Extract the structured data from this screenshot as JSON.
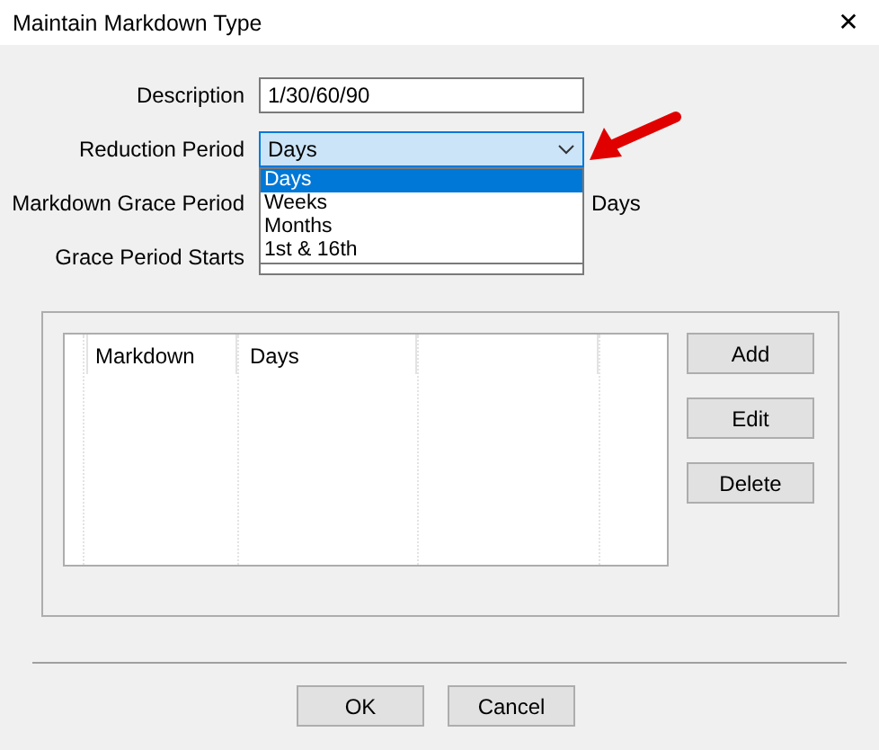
{
  "window": {
    "title": "Maintain Markdown Type",
    "close": "✕"
  },
  "form": {
    "description": {
      "label": "Description",
      "value": "1/30/60/90"
    },
    "reduction_period": {
      "label": "Reduction Period",
      "value": "Days",
      "expanded": true,
      "options": [
        {
          "label": "Days",
          "selected": true
        },
        {
          "label": "Weeks",
          "selected": false
        },
        {
          "label": "Months",
          "selected": false
        },
        {
          "label": "1st & 16th",
          "selected": false
        }
      ]
    },
    "grace_period": {
      "label": "Markdown Grace Period",
      "unit": "Days"
    },
    "grace_period_starts": {
      "label": "Grace Period Starts"
    }
  },
  "table": {
    "columns": [
      "Markdown",
      "Days"
    ]
  },
  "side_buttons": [
    "Add",
    "Edit",
    "Delete"
  ],
  "buttons": [
    "OK",
    "Cancel"
  ]
}
